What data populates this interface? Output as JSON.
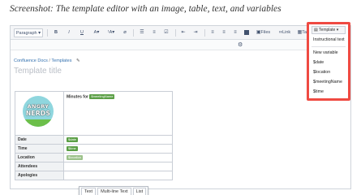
{
  "caption": "Screenshot: The template editor with an image, table, text, and variables",
  "toolbar": {
    "paragraph": "Paragraph",
    "bold": "B",
    "italic": "I",
    "underline": "U",
    "text_color": "A",
    "more_format": "¹A",
    "files": "Files",
    "link": "Link",
    "table": "Table"
  },
  "breadcrumb": {
    "space": "Confluence Docs",
    "separator": "/",
    "parent": "Templates"
  },
  "page_title_placeholder": "Template title",
  "logo": {
    "line1": "ANGRY",
    "line2": "NERDS"
  },
  "table": {
    "minutes_label": "Minutes for",
    "minutes_var": "$meetingName",
    "rows": [
      {
        "label": "Date",
        "var": "$date"
      },
      {
        "label": "Time",
        "var": "$time"
      },
      {
        "label": "Location",
        "var": "$location"
      },
      {
        "label": "Attendees",
        "var": ""
      },
      {
        "label": "Apologies",
        "var": ""
      }
    ]
  },
  "variable_popup": {
    "options": [
      "Text",
      "Multi-line Text",
      "List"
    ]
  },
  "template_menu": {
    "button_label": "Template",
    "instructional_text": "Instructional text",
    "new_variable": "New variable",
    "variables": [
      "$date",
      "$location",
      "$meetingName",
      "$time"
    ]
  },
  "colors": {
    "highlight": "#ef4a42",
    "variable_tag": "#5b9f46",
    "link": "#3572b0"
  }
}
